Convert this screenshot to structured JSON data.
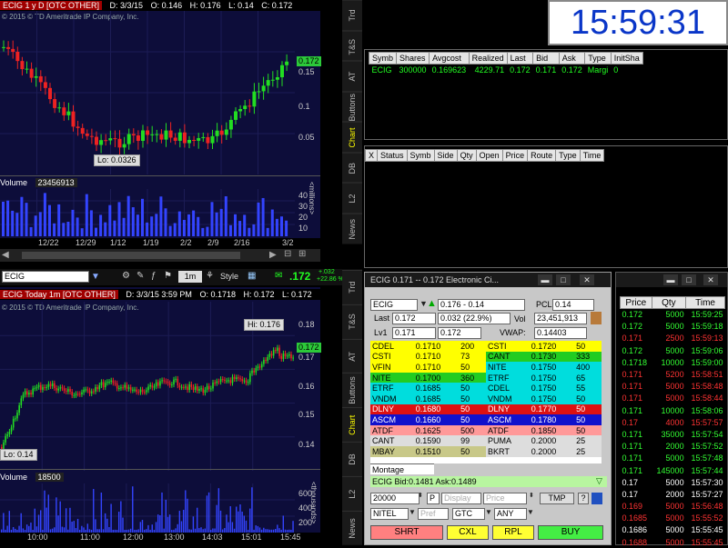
{
  "upper_chart": {
    "header_title": "ECIG 1 y D [OTC OTHER]",
    "header_fields": [
      "D: 3/3/15",
      "O: 0.146",
      "H: 0.176",
      "L: 0.14",
      "C: 0.172"
    ],
    "copyright": "© 2015 © TD Ameritrade IP Company, Inc.",
    "price_axis": [
      "0.15",
      "0.1",
      "0.05"
    ],
    "price_tag": "0.172",
    "low_callout": "Lo: 0.0326",
    "volume_label": "Volume",
    "volume_value": "23456913",
    "volume_axis": [
      "40",
      "30",
      "20",
      "10"
    ],
    "volume_unit": "<millions>",
    "x_axis": [
      "12/22",
      "12/29",
      "1/12",
      "1/19",
      "2/2",
      "2/9",
      "2/16",
      "3/2"
    ]
  },
  "toolbar": {
    "symbol": "ECIG",
    "period": "1m",
    "style_label": "Style",
    "last": ".172",
    "change": "+.032",
    "change_pct": "+22.86 %"
  },
  "lower_chart": {
    "header_title": "ECIG Today 1m [OTC OTHER]",
    "header_fields": [
      "D: 3/3/15 3:59 PM",
      "O: 0.1718",
      "H: 0.172",
      "L: 0.172",
      "C: 0.172"
    ],
    "copyright": "© 2015 © TD Ameritrade IP Company, Inc.",
    "price_axis": [
      "0.18",
      "0.17",
      "0.16",
      "0.15",
      "0.14"
    ],
    "price_tag": "0.172",
    "hi_callout": "Hi: 0.176",
    "lo_callout": "Lo: 0.14",
    "volume_label": "Volume",
    "volume_value": "18500",
    "volume_axis": [
      "600",
      "400",
      "200"
    ],
    "volume_unit": "<thousands>",
    "x_axis": [
      "10:00",
      "11:00",
      "12:00",
      "13:00",
      "14:03",
      "15:01",
      "15:45"
    ]
  },
  "side_tabs_top": [
    "Trd",
    "T&S",
    "AT",
    "Buttons",
    "Chart",
    "DB",
    "L2",
    "News"
  ],
  "side_tabs_bottom": [
    "Trd",
    "T&S",
    "AT",
    "Buttons",
    "Chart",
    "DB",
    "L2",
    "News"
  ],
  "clock": "15:59:31",
  "positions": {
    "columns": [
      "Symb",
      "Shares",
      "Avgcost",
      "Realized",
      "Last",
      "Bid",
      "Ask",
      "Type",
      "InitSha"
    ],
    "rows": [
      [
        "ECIG",
        "300000",
        "0.169623",
        "4229.71",
        "0.172",
        "0.171",
        "0.172",
        "Margi",
        "0"
      ]
    ]
  },
  "orders": {
    "columns": [
      "X",
      "Status",
      "Symb",
      "Side",
      "Qty",
      "Open",
      "Price",
      "Route",
      "Type",
      "Time"
    ]
  },
  "level2": {
    "title": "ECIG  0.171 -- 0.172   Electronic Ci...",
    "symbol": "ECIG",
    "range": "0.176 - 0.14",
    "pcl_label": "PCL",
    "pcl": "0.14",
    "last_label": "Last",
    "last": "0.172",
    "change": "0.032   (22.9%)",
    "vol_label": "Vol",
    "vol": "23,451,913",
    "lv1_label": "Lv1",
    "bid": "0.171",
    "ask": "0.172",
    "vwap_label": "VWAP:",
    "vwap": "0.14403",
    "bids": [
      [
        "CDEL",
        "0.1710",
        "200"
      ],
      [
        "CSTI",
        "0.1710",
        "73"
      ],
      [
        "VFIN",
        "0.1710",
        "50"
      ],
      [
        "NITE",
        "0.1700",
        "360"
      ],
      [
        "ETRF",
        "0.1685",
        "50"
      ],
      [
        "VNDM",
        "0.1685",
        "50"
      ],
      [
        "DLNY",
        "0.1680",
        "50"
      ],
      [
        "ASCM",
        "0.1660",
        "50"
      ],
      [
        "ATDF",
        "0.1625",
        "500"
      ],
      [
        "CANT",
        "0.1590",
        "99"
      ],
      [
        "MBAY",
        "0.1510",
        "50"
      ]
    ],
    "asks": [
      [
        "CSTI",
        "0.1720",
        "50"
      ],
      [
        "CANT",
        "0.1730",
        "333"
      ],
      [
        "NITE",
        "0.1750",
        "400"
      ],
      [
        "ETRF",
        "0.1750",
        "65"
      ],
      [
        "CDEL",
        "0.1750",
        "55"
      ],
      [
        "VNDM",
        "0.1750",
        "50"
      ],
      [
        "DLNY",
        "0.1770",
        "50"
      ],
      [
        "ASCM",
        "0.1780",
        "50"
      ],
      [
        "ATDF",
        "0.1850",
        "50"
      ],
      [
        "PUMA",
        "0.2000",
        "25"
      ],
      [
        "BKRT",
        "0.2000",
        "25"
      ]
    ],
    "montage_tab": "Montage",
    "bbo_line": "ECIG Bid:0.1481 Ask:0.1489",
    "qty": "20000",
    "p_label": "P",
    "display_ph": "Display",
    "price_ph": "Price",
    "tmp_label": "TMP",
    "help": "?",
    "route": "NITEL",
    "pref_ph": "Pref",
    "tif": "GTC",
    "cond": "ANY",
    "btn_short": "SHRT",
    "btn_cancel": "CXL",
    "btn_replace": "RPL",
    "btn_buy": "BUY"
  },
  "time_sales": {
    "columns": [
      "Price",
      "Qty",
      "Time"
    ],
    "rows": [
      [
        "0.172",
        "5000",
        "15:59:25"
      ],
      [
        "0.172",
        "5000",
        "15:59:18"
      ],
      [
        "0.171",
        "2500",
        "15:59:13"
      ],
      [
        "0.172",
        "5000",
        "15:59:06"
      ],
      [
        "0.1718",
        "10000",
        "15:59:00"
      ],
      [
        "0.171",
        "5200",
        "15:58:51"
      ],
      [
        "0.171",
        "5000",
        "15:58:48"
      ],
      [
        "0.171",
        "5000",
        "15:58:44"
      ],
      [
        "0.171",
        "10000",
        "15:58:06"
      ],
      [
        "0.17",
        "4000",
        "15:57:57"
      ],
      [
        "0.171",
        "35000",
        "15:57:54"
      ],
      [
        "0.171",
        "2000",
        "15:57:52"
      ],
      [
        "0.171",
        "5000",
        "15:57:48"
      ],
      [
        "0.171",
        "145000",
        "15:57:44"
      ],
      [
        "0.17",
        "5000",
        "15:57:30"
      ],
      [
        "0.17",
        "2000",
        "15:57:27"
      ],
      [
        "0.169",
        "5000",
        "15:56:48"
      ],
      [
        "0.1685",
        "5000",
        "15:55:52"
      ],
      [
        "0.1686",
        "5000",
        "15:55:45"
      ],
      [
        "0.1688",
        "5000",
        "15:55:45"
      ]
    ],
    "row_colors": [
      "g",
      "g",
      "r",
      "g",
      "g",
      "r",
      "r",
      "r",
      "g",
      "r",
      "g",
      "g",
      "g",
      "g",
      "w",
      "w",
      "r",
      "r",
      "w",
      "r"
    ]
  },
  "colors": {
    "bid_rows": [
      "#ffff00",
      "#ffff00",
      "#ffff00",
      "#22cc22",
      "#00dddd",
      "#00dddd",
      "#dd1111",
      "#1111cc",
      "#ff9999",
      "#dddddd",
      "#c8c888"
    ],
    "ask_rows": [
      "#ffff00",
      "#22cc22",
      "#00dddd",
      "#00dddd",
      "#00dddd",
      "#00dddd",
      "#dd1111",
      "#1111cc",
      "#ff9999",
      "#dddddd",
      "#dddddd"
    ]
  }
}
